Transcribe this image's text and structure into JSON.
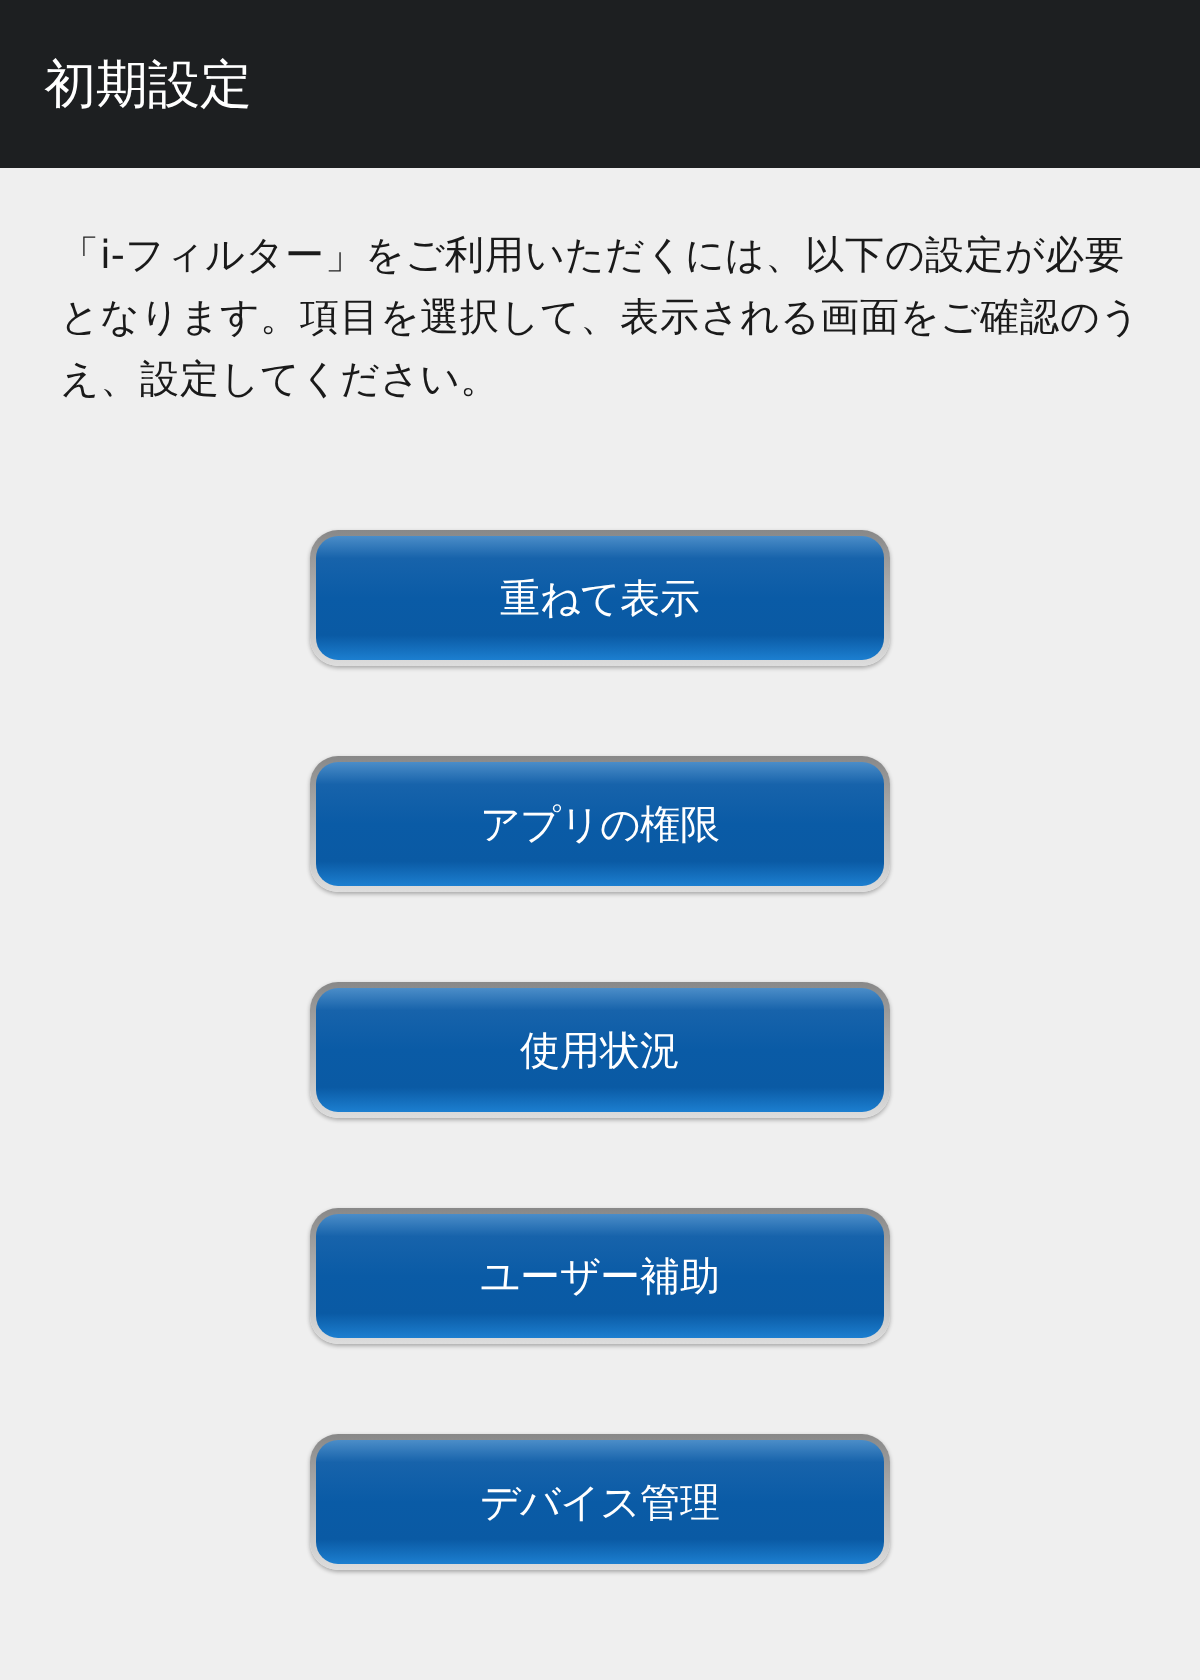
{
  "header": {
    "title": "初期設定"
  },
  "message": "「i-フィルター」をご利用いただくには、以下の設定が必要となります。項目を選択して、表示される画面をご確認のうえ、設定してください。",
  "buttons": [
    {
      "label": "重ねて表示"
    },
    {
      "label": "アプリの権限"
    },
    {
      "label": "使用状況"
    },
    {
      "label": "ユーザー補助"
    },
    {
      "label": "デバイス管理"
    }
  ]
}
